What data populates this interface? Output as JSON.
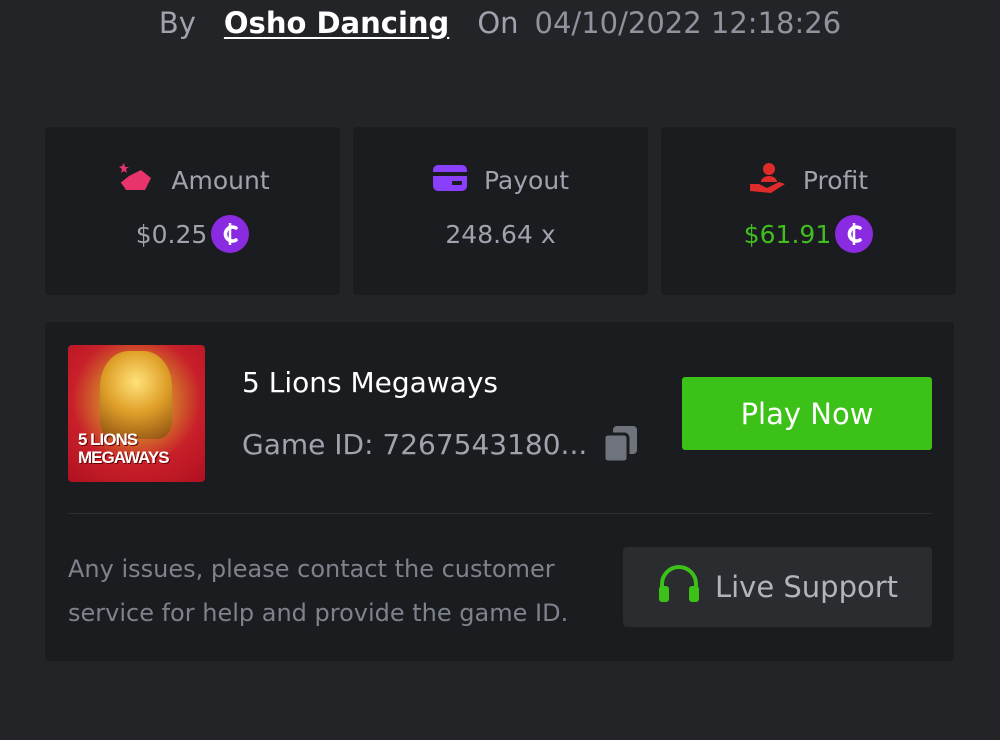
{
  "header": {
    "by_label": "By",
    "username": "Osho Dancing",
    "on_label": "On",
    "timestamp": "04/10/2022 12:18:26"
  },
  "stats": {
    "amount": {
      "label": "Amount",
      "value": "$0.25",
      "icon": "hand-coins-icon",
      "icon_color": "#e8336b"
    },
    "payout": {
      "label": "Payout",
      "value": "248.64 x",
      "icon": "card-icon",
      "icon_color": "#8a3ffc"
    },
    "profit": {
      "label": "Profit",
      "value": "$61.91",
      "icon": "hand-user-icon",
      "icon_color": "#e02b2b",
      "value_color": "#3fbf1f"
    }
  },
  "currency_symbol": "₵",
  "game": {
    "thumbnail_title": "5 LIONS MEGAWAYS",
    "name": "5 Lions Megaways",
    "id_text": "Game ID: 7267543180...",
    "play_label": "Play Now"
  },
  "support": {
    "help_text": "Any issues, please contact the customer service for help and provide the game ID.",
    "button_label": "Live Support"
  },
  "colors": {
    "accent_green": "#3bc117",
    "coin_purple": "#8a2be2",
    "card_bg": "#1b1c1f",
    "page_bg": "#232428"
  }
}
